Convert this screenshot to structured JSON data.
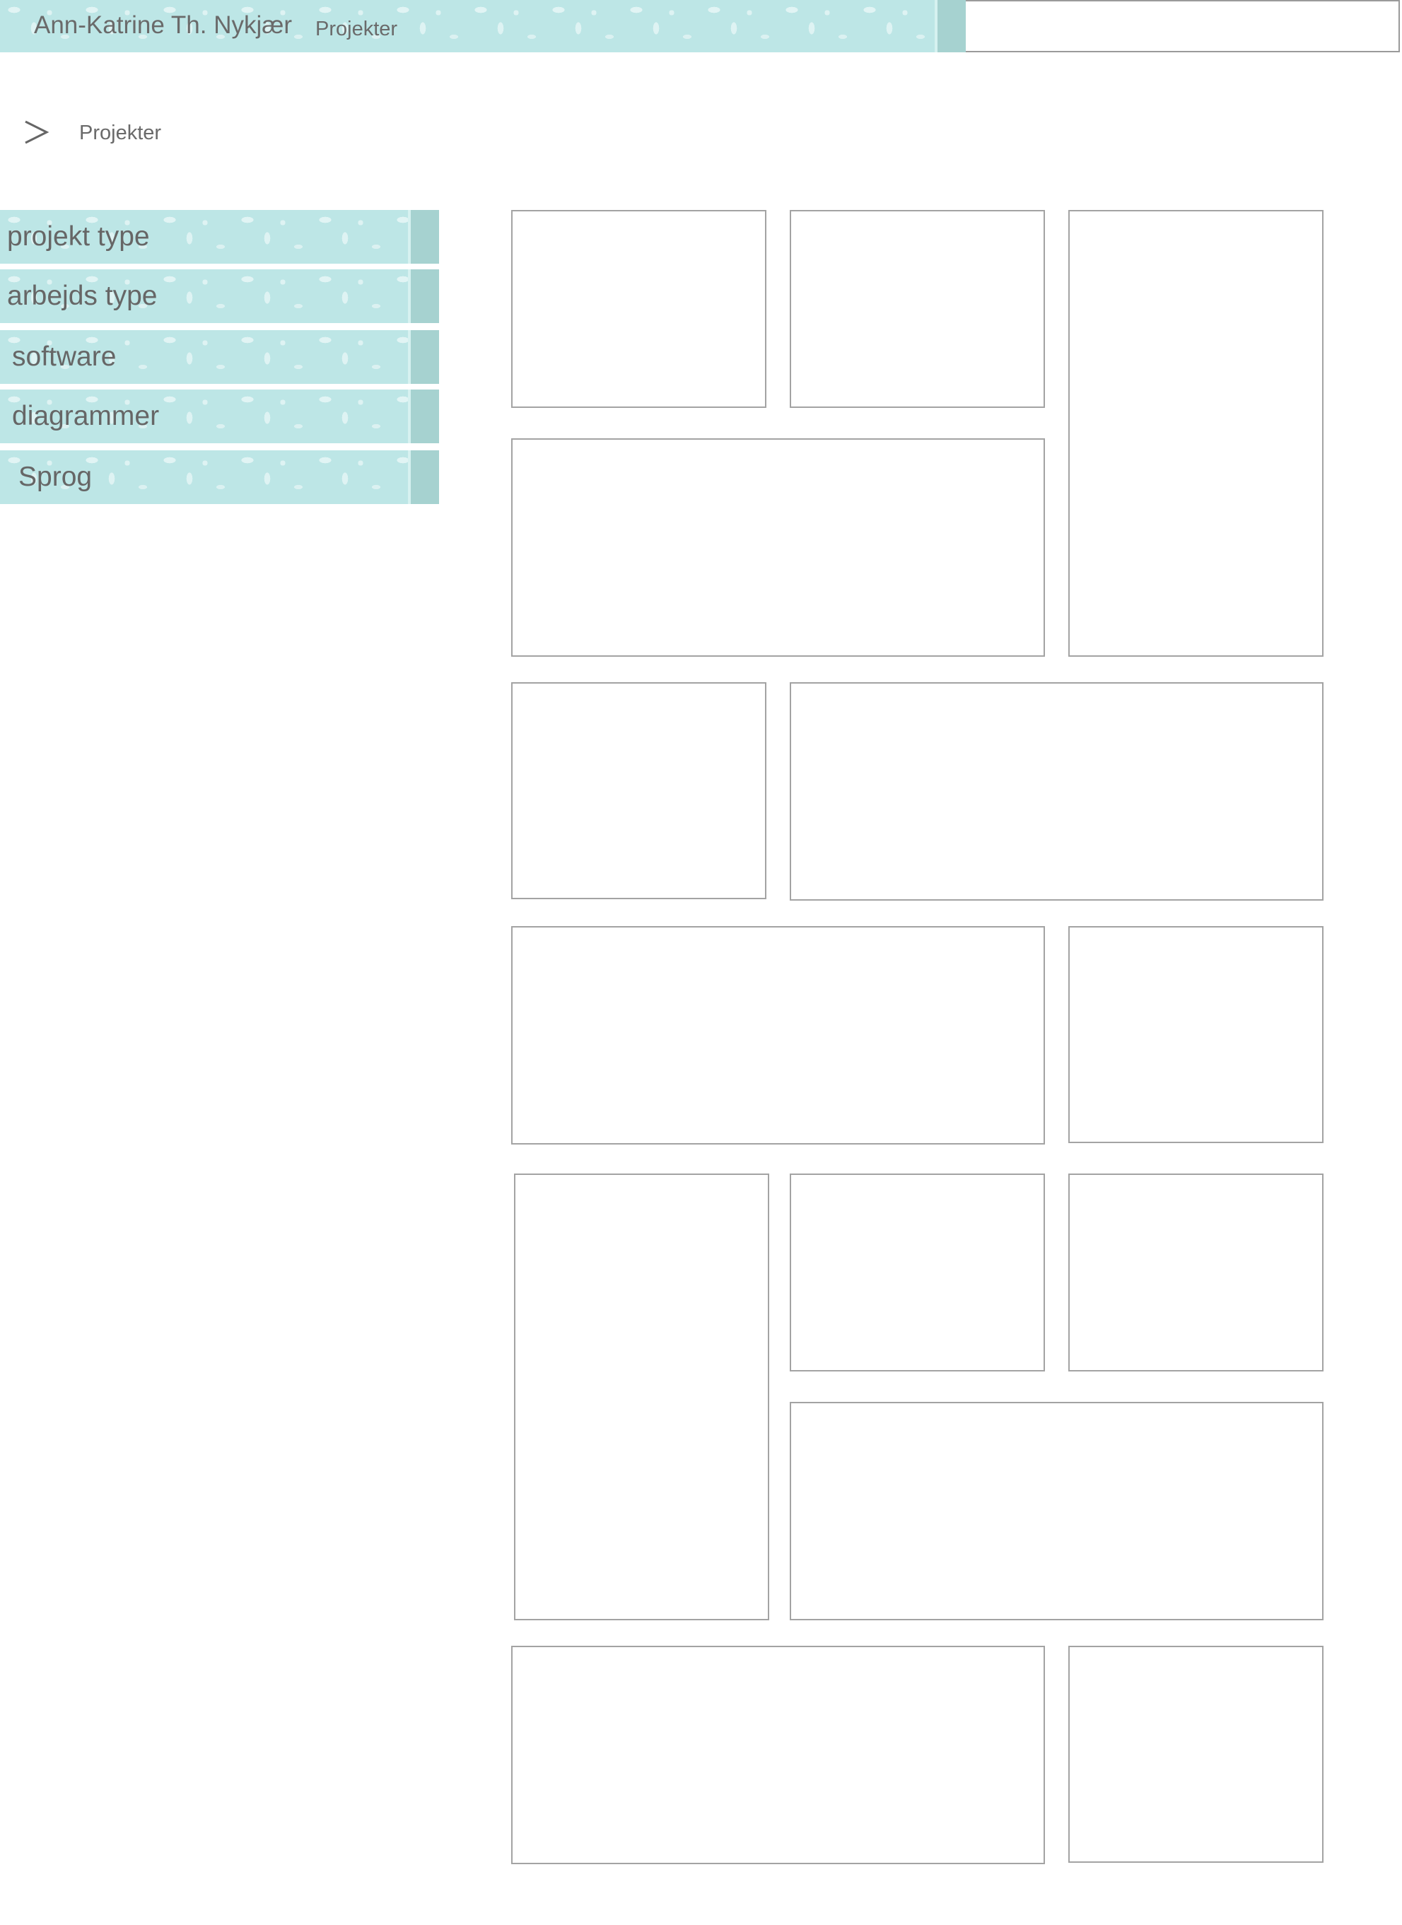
{
  "header": {
    "site_name": "Ann-Katrine Th. Nykjær",
    "section": "Projekter",
    "search_value": ""
  },
  "breadcrumb": {
    "arrow": ">",
    "current": "Projekter"
  },
  "filters": [
    {
      "label": "projekt type"
    },
    {
      "label": "arbejds type"
    },
    {
      "label": "software"
    },
    {
      "label": "diagrammer"
    },
    {
      "label": "Sprog"
    }
  ],
  "colors": {
    "band": "#bde6e6",
    "band_cap": "#a6d2d0",
    "text": "#666666",
    "tile_border": "#a3a3a3"
  }
}
